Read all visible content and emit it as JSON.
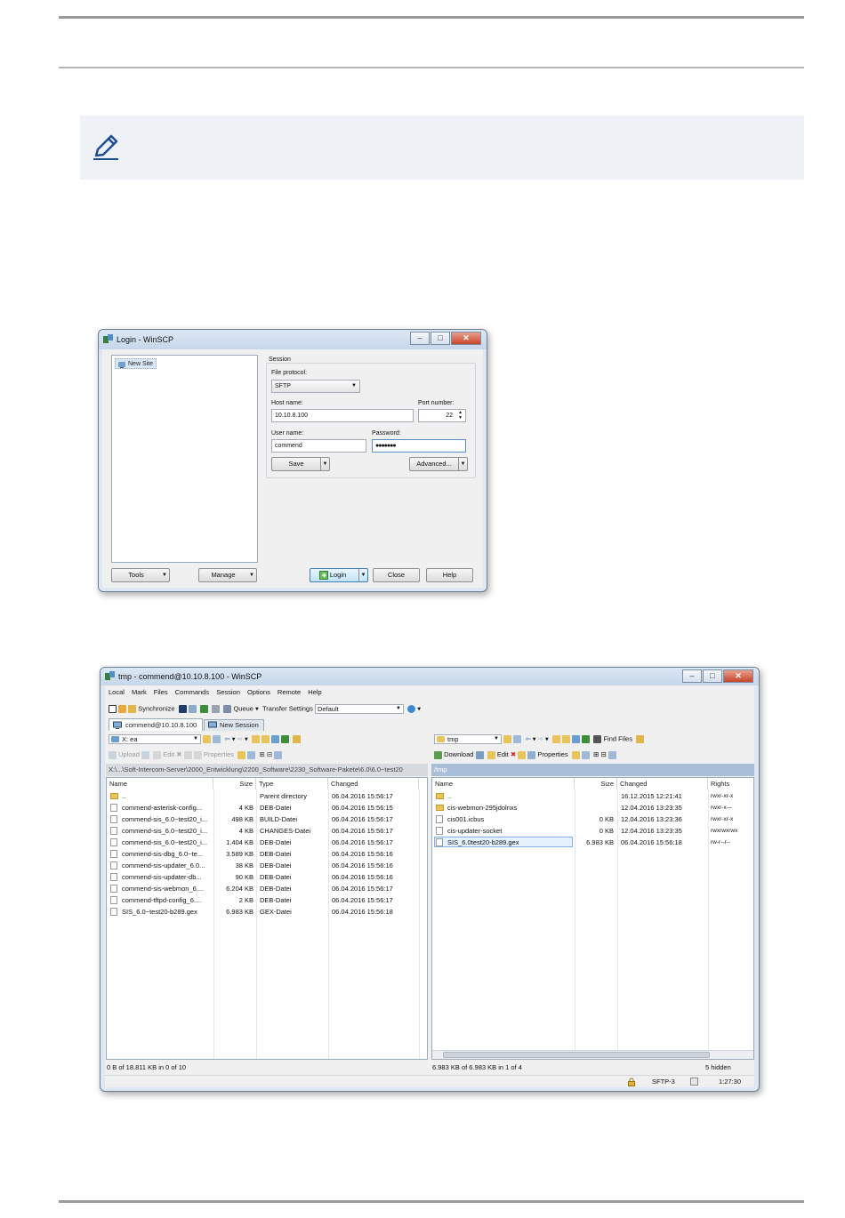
{
  "login": {
    "title": "Login - WinSCP",
    "new_site": "New Site",
    "session_label": "Session",
    "file_protocol_label": "File protocol:",
    "file_protocol_value": "SFTP",
    "host_label": "Host name:",
    "host_value": "10.10.8.100",
    "port_label": "Port number:",
    "port_value": "22",
    "user_label": "User name:",
    "user_value": "commend",
    "password_label": "Password:",
    "password_value": "●●●●●●●",
    "save": "Save",
    "advanced": "Advanced...",
    "tools": "Tools",
    "manage": "Manage",
    "login": "Login",
    "close": "Close",
    "help": "Help"
  },
  "commander": {
    "title": "tmp - commend@10.10.8.100 - WinSCP",
    "menu": [
      "Local",
      "Mark",
      "Files",
      "Commands",
      "Session",
      "Options",
      "Remote",
      "Help"
    ],
    "toolbar": {
      "synchronize": "Synchronize",
      "queue": "Queue",
      "transfer_settings": "Transfer Settings",
      "transfer_value": "Default"
    },
    "tabs": [
      "commend@10.10.8.100",
      "New Session"
    ],
    "left": {
      "drive": "X: ea",
      "upload": "Upload",
      "edit": "Edit",
      "properties": "Properties",
      "path": "X:\\...\\Soft-Intercom-Server\\2000_Entwicklung\\2200_Software\\2230_Software-Pakete\\6.0\\6.0~test20",
      "headers": [
        "Name",
        "Size",
        "Type",
        "Changed"
      ],
      "rows": [
        {
          "name": "..",
          "size": "",
          "type": "Parent directory",
          "changed": "06.04.2016  15:56:17",
          "kind": "up"
        },
        {
          "name": "commend-asterisk-config...",
          "size": "4 KB",
          "type": "DEB-Datei",
          "changed": "06.04.2016  15:56:15",
          "kind": "file"
        },
        {
          "name": "commend-sis_6.0~test20_i...",
          "size": "498 KB",
          "type": "BUILD-Datei",
          "changed": "06.04.2016  15:56:17",
          "kind": "file"
        },
        {
          "name": "commend-sis_6.0~test20_i...",
          "size": "4 KB",
          "type": "CHANGES-Datei",
          "changed": "06.04.2016  15:56:17",
          "kind": "file"
        },
        {
          "name": "commend-sis_6.0~test20_i...",
          "size": "1.404 KB",
          "type": "DEB-Datei",
          "changed": "06.04.2016  15:56:17",
          "kind": "file"
        },
        {
          "name": "commend-sis-dbg_6.0~te...",
          "size": "3.589 KB",
          "type": "DEB-Datei",
          "changed": "06.04.2016  15:56:16",
          "kind": "file"
        },
        {
          "name": "commend-sis-updater_6.0...",
          "size": "38 KB",
          "type": "DEB-Datei",
          "changed": "06.04.2016  15:56:16",
          "kind": "file"
        },
        {
          "name": "commend-sis-updater-db...",
          "size": "90 KB",
          "type": "DEB-Datei",
          "changed": "06.04.2016  15:56:16",
          "kind": "file"
        },
        {
          "name": "commend-sis-webmon_6....",
          "size": "6.204 KB",
          "type": "DEB-Datei",
          "changed": "06.04.2016  15:56:17",
          "kind": "file"
        },
        {
          "name": "commend-tftpd-config_6....",
          "size": "2 KB",
          "type": "DEB-Datei",
          "changed": "06.04.2016  15:56:17",
          "kind": "file"
        },
        {
          "name": "SIS_6.0~test20-b289.gex",
          "size": "6.983 KB",
          "type": "GEX-Datei",
          "changed": "06.04.2016  15:56:18",
          "kind": "file"
        }
      ],
      "status": "0 B of 18.811 KB in 0 of 10"
    },
    "right": {
      "drive": "tmp",
      "download": "Download",
      "edit": "Edit",
      "properties": "Properties",
      "find_files": "Find Files",
      "path": "/tmp",
      "headers": [
        "Name",
        "Size",
        "Changed",
        "Rights"
      ],
      "rows": [
        {
          "name": "..",
          "size": "",
          "changed": "16.12.2015  12:21:41",
          "rights": "rwxr-xr-x",
          "kind": "up"
        },
        {
          "name": "cis-webmon-295jdolnxs",
          "size": "",
          "changed": "12.04.2016  13:23:35",
          "rights": "rwxr-x---",
          "kind": "folder"
        },
        {
          "name": "cis001.icbus",
          "size": "0 KB",
          "changed": "12.04.2016  13:23:36",
          "rights": "rwxr-xr-x",
          "kind": "file"
        },
        {
          "name": "cis-updater-socket",
          "size": "0 KB",
          "changed": "12.04.2016  13:23:35",
          "rights": "rwxrwxrwx",
          "kind": "file"
        },
        {
          "name": "SIS_6.0test20-b289.gex",
          "size": "6.983 KB",
          "changed": "06.04.2016  15:56:18",
          "rights": "rw-r--r--",
          "kind": "file"
        }
      ],
      "status": "6.983 KB of 6.983 KB in 1 of 4",
      "hidden": "5 hidden"
    },
    "protocol": "SFTP-3",
    "time": "1:27:30"
  }
}
